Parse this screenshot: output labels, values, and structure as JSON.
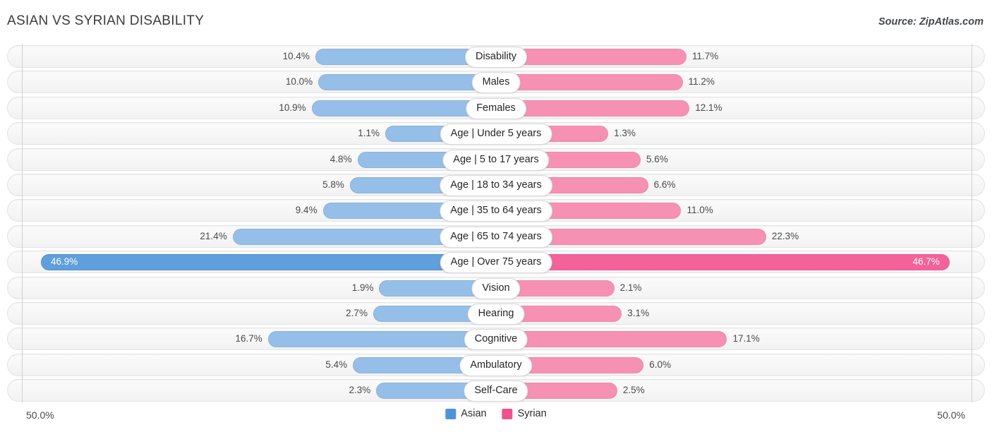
{
  "header": {
    "title": "ASIAN VS SYRIAN DISABILITY",
    "source": "Source: ZipAtlas.com"
  },
  "axis": {
    "left_label": "50.0%",
    "right_label": "50.0%",
    "max": 50.0
  },
  "legend": {
    "items": [
      {
        "label": "Asian",
        "color": "#4d94db"
      },
      {
        "label": "Syrian",
        "color": "#f0518c"
      }
    ]
  },
  "chart_data": {
    "type": "bar",
    "orientation": "horizontal-diverging",
    "title": "ASIAN VS SYRIAN DISABILITY",
    "xlabel": "",
    "ylabel": "",
    "xlim": [
      -50.0,
      50.0
    ],
    "grid": true,
    "legend_position": "bottom-center",
    "categories": [
      "Disability",
      "Males",
      "Females",
      "Age | Under 5 years",
      "Age | 5 to 17 years",
      "Age | 18 to 34 years",
      "Age | 35 to 64 years",
      "Age | 65 to 74 years",
      "Age | Over 75 years",
      "Vision",
      "Hearing",
      "Cognitive",
      "Ambulatory",
      "Self-Care"
    ],
    "series": [
      {
        "name": "Asian",
        "color": "#95bfe8",
        "values": [
          10.4,
          10.0,
          10.9,
          1.1,
          4.8,
          5.8,
          9.4,
          21.4,
          46.9,
          1.9,
          2.7,
          16.7,
          5.4,
          2.3
        ],
        "labels": [
          "10.4%",
          "10.0%",
          "10.9%",
          "1.1%",
          "4.8%",
          "5.8%",
          "9.4%",
          "21.4%",
          "46.9%",
          "1.9%",
          "2.7%",
          "16.7%",
          "5.4%",
          "2.3%"
        ]
      },
      {
        "name": "Syrian",
        "color": "#f791b4",
        "values": [
          11.7,
          11.2,
          12.1,
          1.3,
          5.6,
          6.6,
          11.0,
          22.3,
          46.7,
          2.1,
          3.1,
          17.1,
          6.0,
          2.5
        ],
        "labels": [
          "11.7%",
          "11.2%",
          "12.1%",
          "1.3%",
          "5.6%",
          "6.6%",
          "11.0%",
          "22.3%",
          "46.7%",
          "2.1%",
          "3.1%",
          "17.1%",
          "6.0%",
          "2.5%"
        ]
      }
    ],
    "highlight_row": "Age | Over 75 years"
  }
}
